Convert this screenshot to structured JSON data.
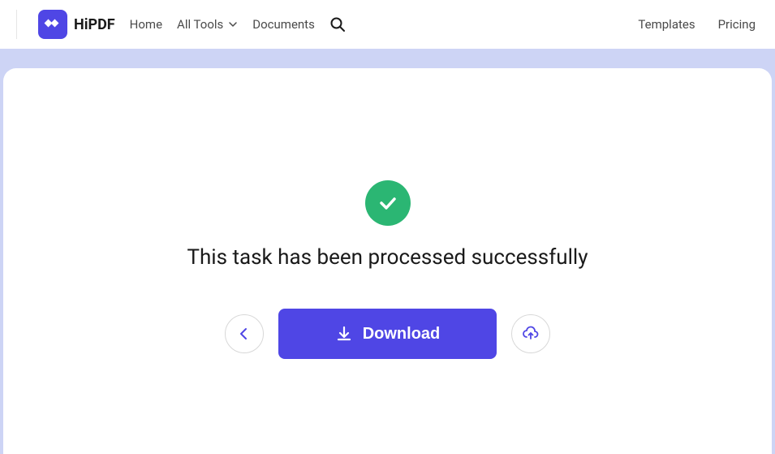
{
  "brand": {
    "name": "HiPDF"
  },
  "nav": {
    "home": "Home",
    "all_tools": "All Tools",
    "documents": "Documents",
    "templates": "Templates",
    "pricing": "Pricing"
  },
  "main": {
    "success_message": "This task has been processed successfully",
    "download_label": "Download"
  }
}
